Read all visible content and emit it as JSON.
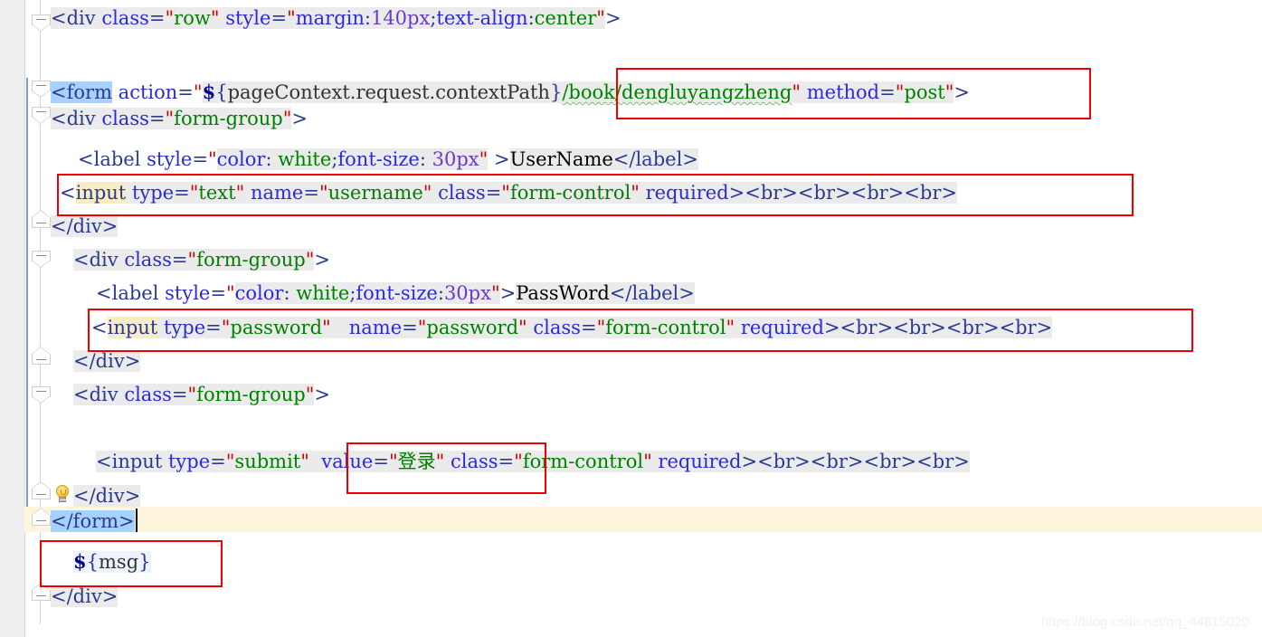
{
  "editor": {
    "watermark": "https://blog.csdn.net/qq_44815020",
    "caret_line_index": 13,
    "colors": {
      "background": "#ffffff",
      "gutter": "#efefef",
      "selection": "#a6d2ff",
      "caret_line": "#fdf6dd",
      "occurrence_highlight": "#ebebeb",
      "element_highlight": "#f7ecc4",
      "el_background": "#eef2fd",
      "annotation_box": "#ee0000",
      "tag": "#2b3a8f",
      "attribute": "#2b2bd6",
      "string_value": "#008000",
      "quote": "#cc0000",
      "number": "#6a3ac8",
      "plain_text": "#000000"
    }
  },
  "code_lines": [
    {
      "id": "line-div-row",
      "indent": 0,
      "text": "<div class=\"row\" style=\"margin:140px;text-align:center\">"
    },
    {
      "id": "line-blank-1",
      "indent": 0,
      "text": ""
    },
    {
      "id": "line-form-open",
      "indent": 0,
      "text": "<form action=\"${pageContext.request.contextPath}/book/dengluyangzheng\" method=\"post\">"
    },
    {
      "id": "line-div-formgroup-1",
      "indent": 0,
      "text": "<div class=\"form-group\">"
    },
    {
      "id": "line-label-username",
      "indent": 1,
      "text": "<label style=\"color: white;font-size: 30px\" >UserName</label>"
    },
    {
      "id": "line-input-username",
      "indent": 1,
      "text": "<input type=\"text\" name=\"username\" class=\"form-control\" required><br><br><br><br>"
    },
    {
      "id": "line-div-close-1",
      "indent": 0,
      "text": "</div>"
    },
    {
      "id": "line-div-formgroup-2",
      "indent": 1,
      "text": "<div class=\"form-group\">"
    },
    {
      "id": "line-label-password",
      "indent": 2,
      "text": "<label style=\"color: white;font-size:30px\">PassWord</label>"
    },
    {
      "id": "line-input-password",
      "indent": 2,
      "text": "<input type=\"password\"   name=\"password\" class=\"form-control\" required><br><br><br><br>"
    },
    {
      "id": "line-div-close-2",
      "indent": 1,
      "text": "</div>"
    },
    {
      "id": "line-div-formgroup-3",
      "indent": 1,
      "text": "<div class=\"form-group\">"
    },
    {
      "id": "line-blank-2",
      "indent": 0,
      "text": ""
    },
    {
      "id": "line-input-submit",
      "indent": 2,
      "text": "<input type=\"submit\"  value=\"登录\" class=\"form-control\" required><br><br><br><br>"
    },
    {
      "id": "line-div-close-3",
      "indent": 1,
      "text": "</div>"
    },
    {
      "id": "line-form-close",
      "indent": 0,
      "text": "</form>"
    },
    {
      "id": "line-el-msg",
      "indent": 1,
      "text": "${msg}"
    },
    {
      "id": "line-div-close-4",
      "indent": 0,
      "text": "</div>"
    }
  ],
  "tokens": {
    "lt": "<",
    "gt": ">",
    "lt_slash": "</",
    "eq": "=",
    "quote": "\"",
    "br": "<br>",
    "div": "div",
    "form": "form",
    "label": "label",
    "input": "input",
    "class_attr": "class",
    "style_attr": "style",
    "action_attr": "action",
    "method_attr": "method",
    "type_attr": "type",
    "name_attr": "name",
    "value_attr": "value",
    "required_attr": "required",
    "val_row": "row",
    "val_form_group": "form-group",
    "val_form_control": "form-control",
    "val_post": "post",
    "val_text": "text",
    "val_password": "password",
    "val_submit": "submit",
    "val_denglu": "登录",
    "val_username": "username",
    "css_margin": "margin",
    "css_margin_val": "140px",
    "css_text_align": "text-align",
    "css_center": "center",
    "css_color": "color",
    "css_white": "white",
    "css_font_size": "font-size",
    "css_30px": "30px",
    "el_open": "${",
    "el_close": "}",
    "el_page_context": "pageContext.request.contextPath",
    "el_msg": "msg",
    "path_denglu": "/book/dengluyangzheng",
    "text_username": "UserName",
    "text_password": "PassWord",
    "dollar": "$"
  },
  "annotations": [
    {
      "id": "box-form-action",
      "label": "form-action-path"
    },
    {
      "id": "box-input-user",
      "label": "username-input-tag"
    },
    {
      "id": "box-input-pass",
      "label": "password-input-tag"
    },
    {
      "id": "box-submit-value",
      "label": "submit-value-attribute"
    },
    {
      "id": "box-el-msg",
      "label": "msg-expression"
    }
  ],
  "gutter": {
    "fold_markers": 9,
    "bulb_tooltip": "show-intention-actions"
  }
}
